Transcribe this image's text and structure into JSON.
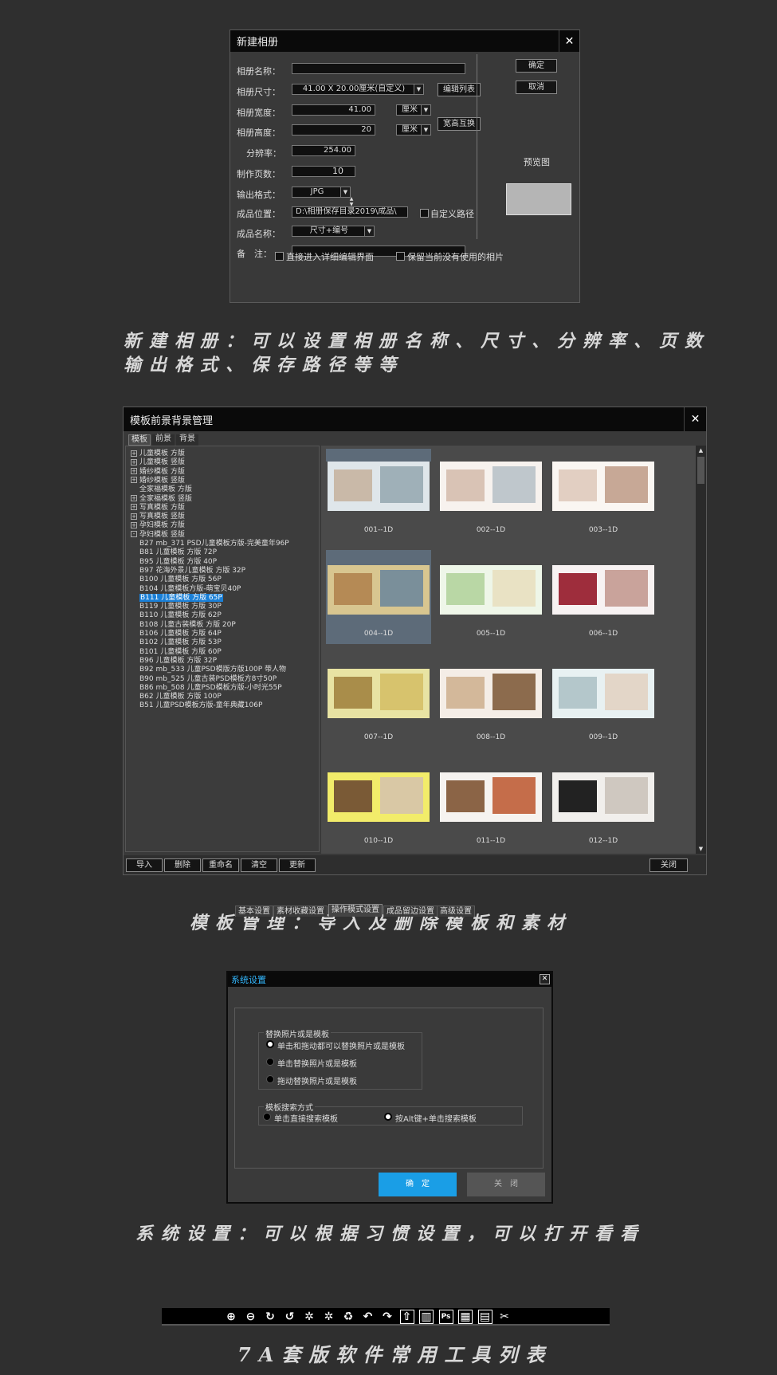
{
  "new_album": {
    "title": "新建相册",
    "close": "✕",
    "fields": {
      "name_label": "相册名称：",
      "name_value": "",
      "size_label": "相册尺寸：",
      "size_value": "41.00 X 20.00厘米(自定义)",
      "edit_list_button": "编辑列表",
      "width_label": "相册宽度：",
      "width_value": "41.00",
      "width_unit": "厘米",
      "height_label": "相册高度：",
      "height_value": "20",
      "height_unit": "厘米",
      "swap_button": "宽高互换",
      "dpi_label": "分辨率：",
      "dpi_value": "254.00",
      "pages_label": "制作页数：",
      "pages_value": "10",
      "format_label": "输出格式：",
      "format_value": "JPG",
      "path_label": "成品位置：",
      "path_value": "D:\\相册保存目录2019\\成品\\",
      "custom_path_label": "自定义路径",
      "output_name_label": "成品名称：",
      "output_name_value": "尺寸+编号",
      "note_label": "备　注：",
      "note_value": ""
    },
    "ok_button": "确定",
    "cancel_button": "取消",
    "preview_label": "预览图",
    "check_detail": "直接进入详细编辑界面",
    "check_keep": "保留当前没有使用的相片"
  },
  "caption1_line1": "新建相册：可以设置相册名称、尺寸、分辨率、页数",
  "caption1_line2": "输出格式、保存路径等等",
  "template_mgr": {
    "title": "模板前景背景管理",
    "close": "✕",
    "tabs": [
      "模板",
      "前景",
      "背景"
    ],
    "tree": [
      {
        "text": "儿童模板 方版",
        "pm": "+"
      },
      {
        "text": "儿童模板 竖版",
        "pm": "+"
      },
      {
        "text": "婚纱模板 方版",
        "pm": "+"
      },
      {
        "text": "婚纱模板 竖版",
        "pm": "+"
      },
      {
        "text": "全家福模板 方版",
        "pm": ""
      },
      {
        "text": "全家福模板 竖版",
        "pm": "+"
      },
      {
        "text": "写真模板 方版",
        "pm": "+"
      },
      {
        "text": "写真模板 竖版",
        "pm": "+"
      },
      {
        "text": "孕妇模板 方版",
        "pm": "+"
      },
      {
        "text": "孕妇模板 竖版",
        "pm": "-"
      },
      {
        "text": "B27 mb_371 PSD儿童模板方版-完美童年96P",
        "pm": "child"
      },
      {
        "text": "B81 儿童模板 方版 72P",
        "pm": "child"
      },
      {
        "text": "B95 儿童模板 方版 40P",
        "pm": "child"
      },
      {
        "text": "B97 花海外景儿童模板 方版 32P",
        "pm": "child"
      },
      {
        "text": "B100 儿童模板 方版 56P",
        "pm": "child"
      },
      {
        "text": "B104 儿童模板方版-萌宝贝40P",
        "pm": "child"
      },
      {
        "text": "B111 儿童模板 方版 65P",
        "pm": "selected"
      },
      {
        "text": "B119  儿童模板 方版 30P",
        "pm": "child"
      },
      {
        "text": "B110 儿童模板 方版 62P",
        "pm": "child"
      },
      {
        "text": "B108   儿童古装模板 方版 20P",
        "pm": "child"
      },
      {
        "text": "B106  儿童模板 方版 64P",
        "pm": "child"
      },
      {
        "text": "B102  儿童模板 方版  53P",
        "pm": "child"
      },
      {
        "text": "B101  儿童模板 方版 60P",
        "pm": "child"
      },
      {
        "text": "B96 儿童模板 方版 32P",
        "pm": "child"
      },
      {
        "text": "B92 mb_533 儿童PSD模版方版100P 带人物",
        "pm": "child"
      },
      {
        "text": "B90 mb_525 儿童古装PSD模板方8寸50P",
        "pm": "child"
      },
      {
        "text": "B86 mb_508 儿童PSD模板方版-小时光55P",
        "pm": "child"
      },
      {
        "text": "B62 儿童模板 方版 100P",
        "pm": "child"
      },
      {
        "text": "B51 儿童PSD模板方版-童年典藏106P",
        "pm": "child"
      }
    ],
    "thumbs": [
      "001--1D",
      "002--1D",
      "003--1D",
      "004--1D",
      "005--1D",
      "006--1D",
      "007--1D",
      "008--1D",
      "009--1D",
      "010--1D",
      "011--1D",
      "012--1D"
    ],
    "bottom_buttons": [
      "导入",
      "删除",
      "重命名",
      "清空",
      "更新"
    ],
    "close_button": "关闭"
  },
  "caption2": "模板管理：导入及删除模板和素材",
  "settings": {
    "title": "系统设置",
    "close": "✕",
    "tabs": [
      "基本设置",
      "素材收藏设置",
      "操作模式设置",
      "成品留边设置",
      "高级设置"
    ],
    "group1_title": "替换照片或是模板",
    "group1_options": [
      "单击和拖动都可以替换照片或是模板",
      "单击替换照片或是模板",
      "拖动替换照片或是模板"
    ],
    "group2_title": "模板搜索方式",
    "group2_options": [
      "单击直接搜索模板",
      "按Alt键+单击搜索模板"
    ],
    "ok_button": "确　定",
    "close_button": "关　闭",
    "accent": "#1a9ee6"
  },
  "caption3": "系统设置：可以根据习惯设置，可以打开看看",
  "toolbar_icons": [
    "zoom-in-icon",
    "zoom-out-icon",
    "rotate-right-icon",
    "rotate-left-icon",
    "butterfly-icon",
    "swap-icon",
    "recycle-icon",
    "undo-icon",
    "redo-icon",
    "up-icon",
    "columns-icon",
    "ps-icon",
    "save-icon",
    "save-as-icon",
    "scissors-icon"
  ],
  "toolbar_glyphs": [
    "⊕",
    "⊖",
    "↻",
    "↺",
    "✲",
    "✲",
    "♻",
    "↶",
    "↷",
    "⇧",
    "▥",
    "Ps",
    "▦",
    "▤",
    "✂"
  ],
  "caption4": "7A套版软件常用工具列表"
}
